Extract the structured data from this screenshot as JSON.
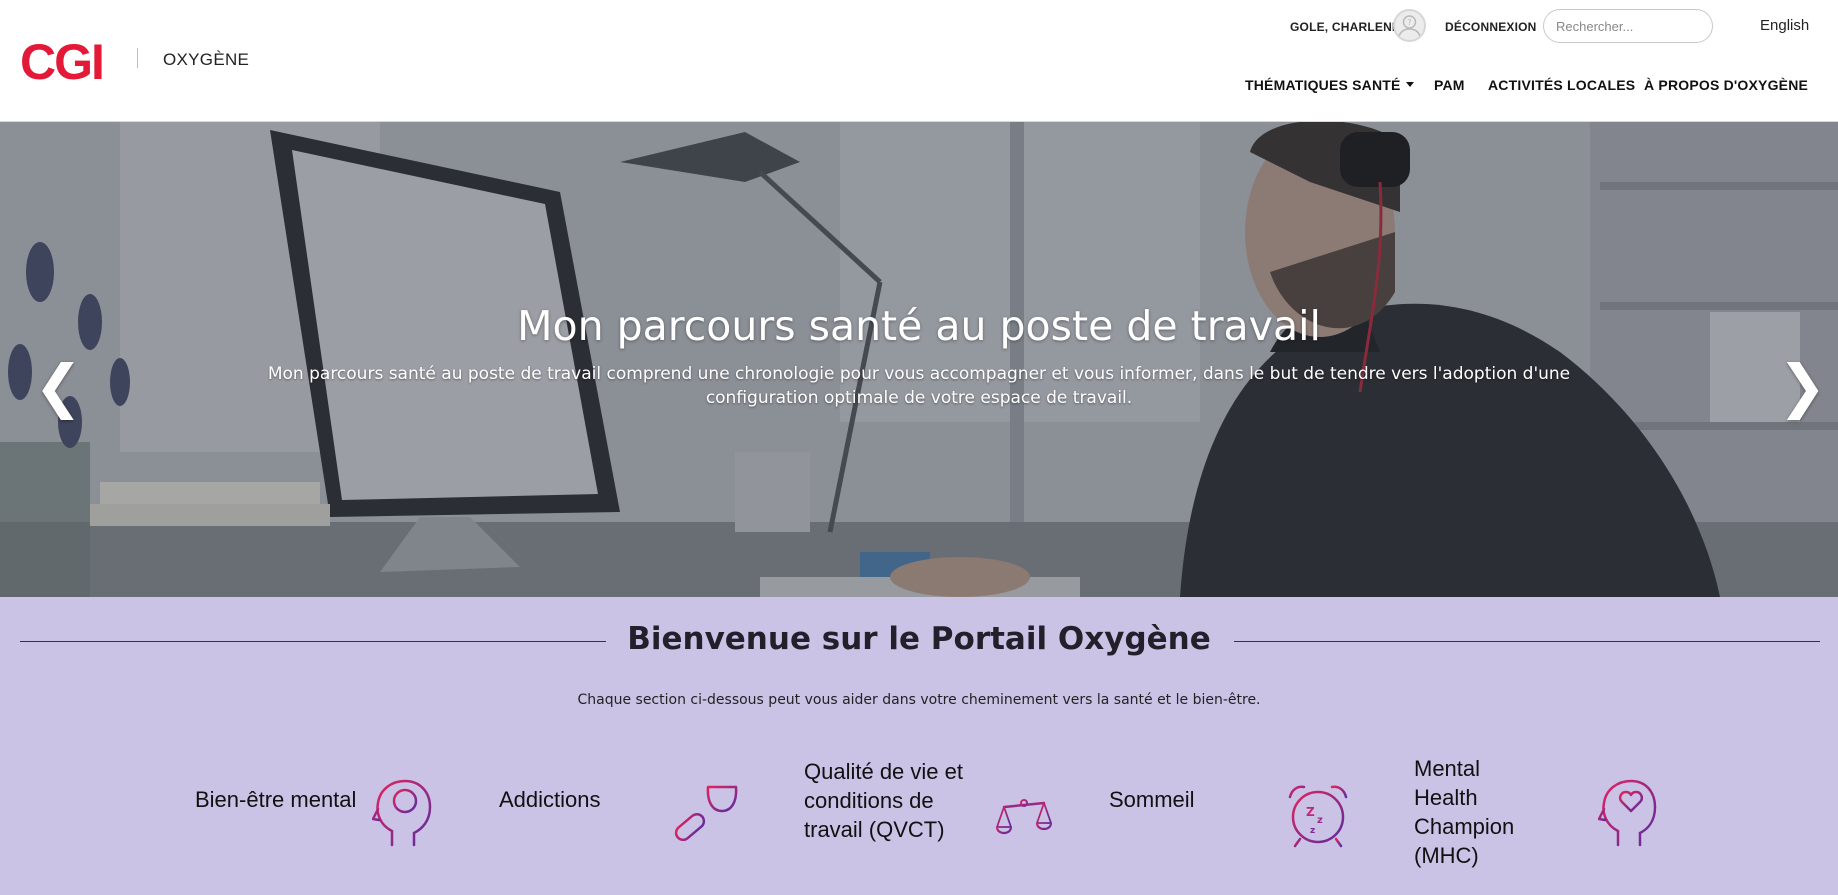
{
  "header": {
    "logo_text": "CGI",
    "app_name": "OXYGÈNE",
    "user_name": "GOLE, CHARLENE",
    "logout_label": "DÉCONNEXION",
    "search_placeholder": "Rechercher...",
    "language_link": "English",
    "nav": [
      {
        "label": "THÉMATIQUES SANTÉ",
        "has_dropdown": true
      },
      {
        "label": "PAM"
      },
      {
        "label": "ACTIVITÉS LOCALES"
      },
      {
        "label": "À PROPOS D'OXYGÈNE"
      }
    ]
  },
  "hero": {
    "title": "Mon parcours santé au poste de travail",
    "description": "Mon parcours santé au poste de travail comprend une chronologie pour vous accompagner et vous informer, dans le but de tendre vers l'adoption d'une configuration optimale de votre espace de travail.",
    "prev_symbol": "❮",
    "next_symbol": "❯"
  },
  "welcome": {
    "title": "Bienvenue sur le Portail Oxygène",
    "subtitle": "Chaque section ci-dessous peut vous aider dans votre cheminement vers la santé et le bien-être.",
    "categories": [
      {
        "label": "Bien-être mental",
        "icon": "head-plus-icon"
      },
      {
        "label": "Addictions",
        "icon": "wine-pill-icon"
      },
      {
        "label": "Qualité de vie et conditions de travail (QVCT)",
        "icon": "balance-scale-icon"
      },
      {
        "label": "Sommeil",
        "icon": "alarm-clock-zzz-icon"
      },
      {
        "label": "Mental Health Champion (MHC)",
        "icon": "head-heart-icon"
      }
    ]
  },
  "colors": {
    "brand_red": "#e31937",
    "welcome_background": "#cbc3e6",
    "icon_gradient_start": "#e0245e",
    "icon_gradient_end": "#5b2ca0"
  }
}
